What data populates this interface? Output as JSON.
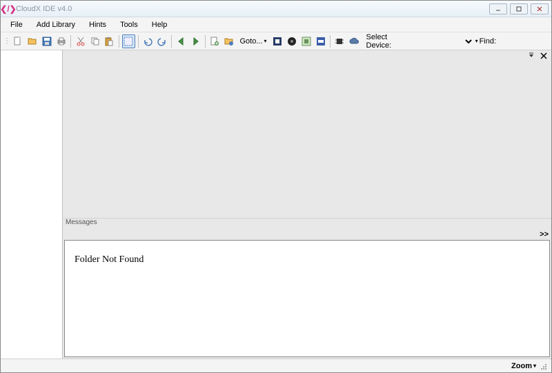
{
  "window": {
    "title": "CloudX IDE v4.0"
  },
  "menu": {
    "file": "File",
    "add_library": "Add Library",
    "hints": "Hints",
    "tools": "Tools",
    "help": "Help"
  },
  "toolbar": {
    "goto": "Goto...",
    "select_device_label": "Select Device:",
    "device_value": "",
    "find_label": "Find:",
    "find_value": ""
  },
  "panels": {
    "messages_label": "Messages",
    "messages_body": "Folder Not Found",
    "messages_more": ">>"
  },
  "status": {
    "zoom": "Zoom"
  }
}
